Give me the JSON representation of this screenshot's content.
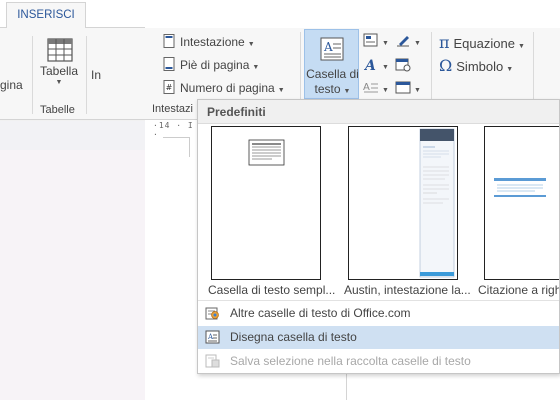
{
  "left_window": {
    "tab_active": "INSERISCI",
    "pagina_cut": "gina",
    "tabella_label": "Tabella",
    "group_tabelle": "Tabelle",
    "ins_cut": "In"
  },
  "ribbon": {
    "intestazione": "Intestazione",
    "pie_di_pagina": "Piè di pagina",
    "numero_di_pagina": "Numero di pagina",
    "group_intestazione_cut": "Intestazi",
    "casella_line1": "Casella di",
    "casella_line2": "testo",
    "equazione": "Equazione",
    "simbolo": "Simbolo"
  },
  "ruler_text": "·14 · I ·",
  "gallery": {
    "header": "Predefiniti",
    "thumbnails": [
      "Casella di testo sempl...",
      "Austin, intestazione la...",
      "Citazione a righe"
    ]
  },
  "menu": {
    "item1": "Altre caselle di testo di Office.com",
    "item2": "Disegna casella di testo",
    "item3": "Salva selezione nella raccolta caselle di testo"
  },
  "colors": {
    "accent": "#2b579a",
    "highlight": "#cfe0f2",
    "pressed": "#c5dcf3"
  }
}
